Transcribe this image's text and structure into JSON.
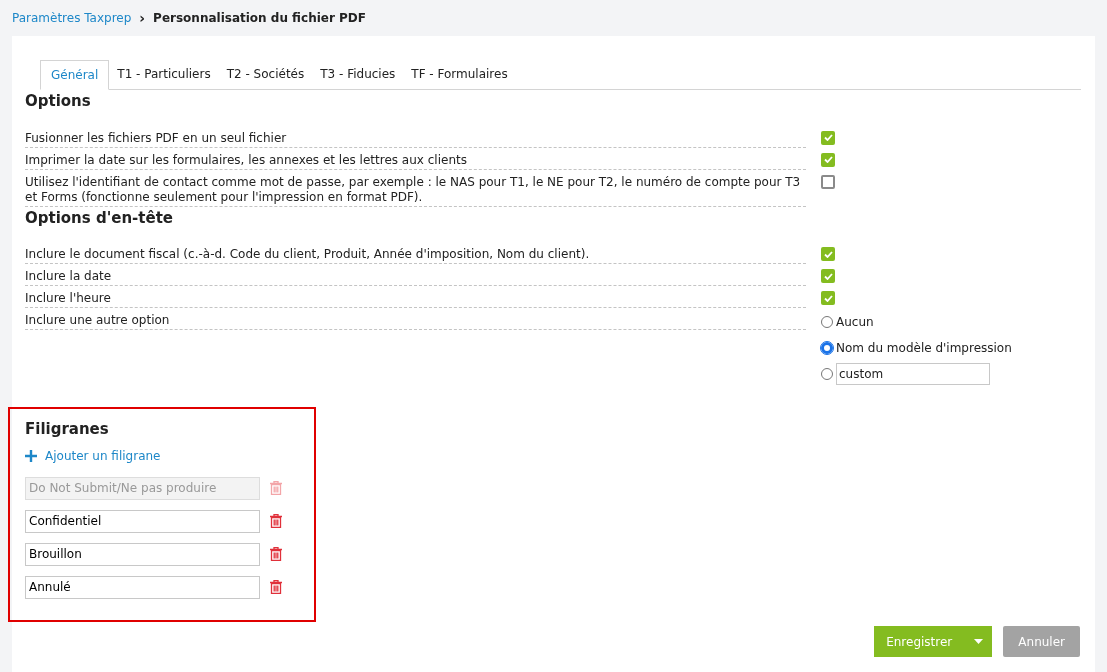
{
  "breadcrumb": {
    "parent": "Paramètres Taxprep",
    "separator": "›",
    "current": "Personnalisation du fichier PDF"
  },
  "tabs": [
    {
      "label": "Général",
      "selected": true
    },
    {
      "label": "T1 - Particuliers",
      "selected": false
    },
    {
      "label": "T2 - Sociétés",
      "selected": false
    },
    {
      "label": "T3 - Fiducies",
      "selected": false
    },
    {
      "label": "TF - Formulaires",
      "selected": false
    }
  ],
  "options": {
    "title": "Options",
    "rows": [
      {
        "label": "Fusionner les fichiers PDF en un seul fichier",
        "checked": true
      },
      {
        "label": "Imprimer la date sur les formulaires, les annexes et les lettres aux clients",
        "checked": true
      },
      {
        "label": "Utilisez l'identifiant de contact comme mot de passe, par exemple : le NAS pour T1, le NE pour T2, le numéro de compte pour T3 et Forms (fonctionne seulement pour l'impression en format PDF).",
        "checked": false
      }
    ]
  },
  "header_options": {
    "title": "Options d'en-tête",
    "rows": [
      {
        "label": "Inclure le document fiscal (c.-à-d. Code du client, Produit, Année d'imposition, Nom du client).",
        "kind": "checkbox",
        "checked": true
      },
      {
        "label": "Inclure la date",
        "kind": "checkbox",
        "checked": true
      },
      {
        "label": "Inclure l'heure",
        "kind": "checkbox",
        "checked": true
      },
      {
        "label": "Inclure une autre option",
        "kind": "radio",
        "choices": [
          {
            "kind": "label",
            "label": "Aucun",
            "selected": false
          },
          {
            "kind": "label",
            "label": "Nom du modèle d'impression",
            "selected": true
          },
          {
            "kind": "field",
            "value": "custom",
            "selected": false
          }
        ]
      }
    ]
  },
  "watermarks": {
    "title": "Filigranes",
    "add_label": "Ajouter un filigrane",
    "items": [
      {
        "value": "Do Not Submit/Ne pas produire",
        "disabled": true
      },
      {
        "value": "Confidentiel",
        "disabled": false
      },
      {
        "value": "Brouillon",
        "disabled": false
      },
      {
        "value": "Annulé",
        "disabled": false
      }
    ]
  },
  "buttons": {
    "save": "Enregistrer",
    "cancel": "Annuler"
  }
}
